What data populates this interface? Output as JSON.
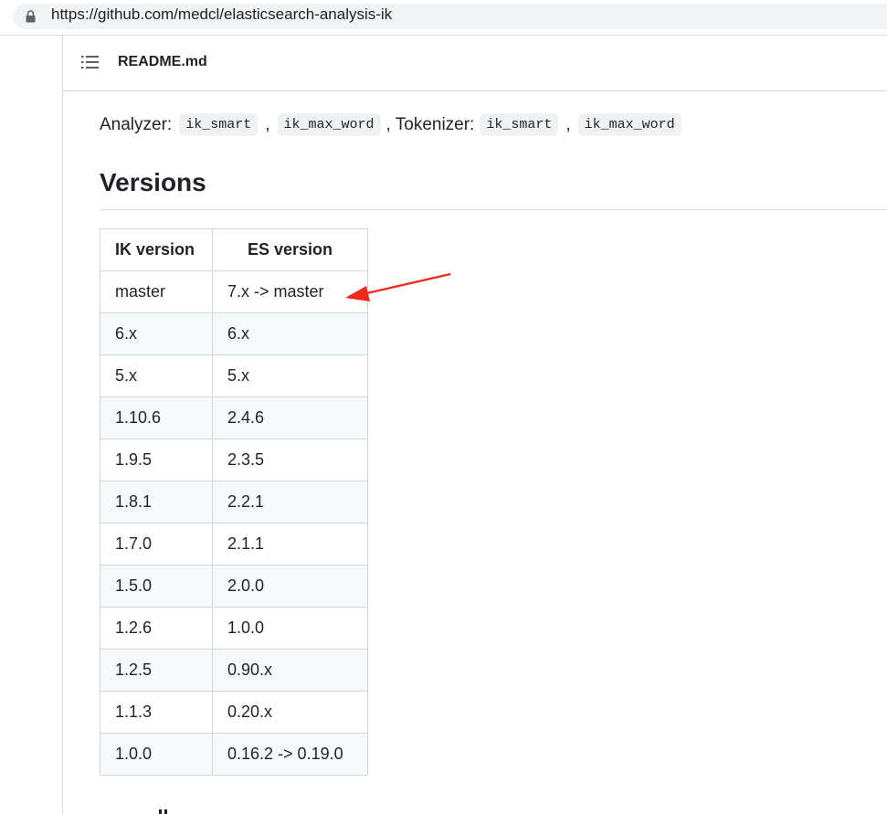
{
  "browser": {
    "url": "https://github.com/medcl/elasticsearch-analysis-ik"
  },
  "readme": {
    "filename": "README.md"
  },
  "analyzer_line": {
    "analyzer_label": "Analyzer:",
    "analyzer_1": "ik_smart",
    "comma_1": ",",
    "analyzer_2": "ik_max_word",
    "tokenizer_label": ", Tokenizer:",
    "tokenizer_1": "ik_smart",
    "comma_2": ",",
    "tokenizer_2": "ik_max_word"
  },
  "versions": {
    "heading": "Versions",
    "columns": [
      "IK version",
      "ES version"
    ],
    "rows": [
      [
        "master",
        "7.x -> master"
      ],
      [
        "6.x",
        "6.x"
      ],
      [
        "5.x",
        "5.x"
      ],
      [
        "1.10.6",
        "2.4.6"
      ],
      [
        "1.9.5",
        "2.3.5"
      ],
      [
        "1.8.1",
        "2.2.1"
      ],
      [
        "1.7.0",
        "2.1.1"
      ],
      [
        "1.5.0",
        "2.0.0"
      ],
      [
        "1.2.6",
        "1.0.0"
      ],
      [
        "1.2.5",
        "0.90.x"
      ],
      [
        "1.1.3",
        "0.20.x"
      ],
      [
        "1.0.0",
        "0.16.2 -> 0.19.0"
      ]
    ]
  },
  "annotation": {
    "arrow_color": "#f0291f",
    "icon": "red-arrow-icon"
  }
}
